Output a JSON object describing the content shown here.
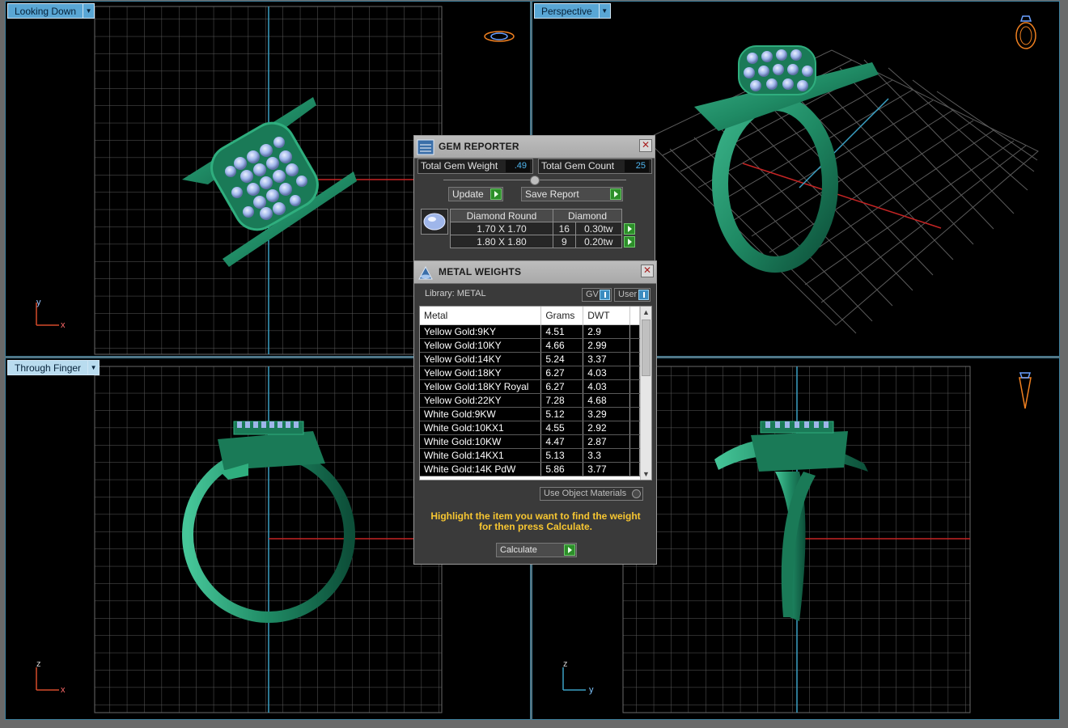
{
  "viewports": {
    "top_left": {
      "label": "Looking Down",
      "axis_v": "y",
      "axis_h": "x"
    },
    "top_right": {
      "label": "Perspective"
    },
    "bottom_left": {
      "label": "Through Finger",
      "axis_v": "z",
      "axis_h": "x"
    },
    "bottom_right": {
      "axis_v": "z",
      "axis_h": "y"
    }
  },
  "gem_reporter": {
    "title": "GEM REPORTER",
    "total_weight_label": "Total Gem Weight",
    "total_weight_value": ".49",
    "total_count_label": "Total Gem Count",
    "total_count_value": "25",
    "update_label": "Update",
    "save_report_label": "Save Report",
    "headers": [
      "Diamond Round",
      "Diamond"
    ],
    "rows": [
      {
        "size": "1.70 X 1.70",
        "count": "16",
        "weight": "0.30tw"
      },
      {
        "size": "1.80 X 1.80",
        "count": "9",
        "weight": "0.20tw"
      }
    ]
  },
  "metal_weights": {
    "title": "METAL WEIGHTS",
    "library_label": "Library: METAL",
    "gv_label": "GV",
    "user_label": "User",
    "headers": {
      "metal": "Metal",
      "grams": "Grams",
      "dwt": "DWT"
    },
    "rows": [
      {
        "metal": "Yellow Gold:9KY",
        "grams": "4.51",
        "dwt": "2.9"
      },
      {
        "metal": "Yellow Gold:10KY",
        "grams": "4.66",
        "dwt": "2.99"
      },
      {
        "metal": "Yellow Gold:14KY",
        "grams": "5.24",
        "dwt": "3.37"
      },
      {
        "metal": "Yellow Gold:18KY",
        "grams": "6.27",
        "dwt": "4.03"
      },
      {
        "metal": "Yellow Gold:18KY Royal",
        "grams": "6.27",
        "dwt": "4.03"
      },
      {
        "metal": "Yellow Gold:22KY",
        "grams": "7.28",
        "dwt": "4.68"
      },
      {
        "metal": "White Gold:9KW",
        "grams": "5.12",
        "dwt": "3.29"
      },
      {
        "metal": "White Gold:10KX1",
        "grams": "4.55",
        "dwt": "2.92"
      },
      {
        "metal": "White Gold:10KW",
        "grams": "4.47",
        "dwt": "2.87"
      },
      {
        "metal": "White Gold:14KX1",
        "grams": "5.13",
        "dwt": "3.3"
      },
      {
        "metal": "White Gold:14K PdW",
        "grams": "5.86",
        "dwt": "3.77"
      }
    ],
    "use_object_materials_label": "Use Object Materials",
    "hint_line1": "Highlight the item you want to find the weight",
    "hint_line2": "for then press Calculate.",
    "calculate_label": "Calculate"
  },
  "colors": {
    "ring_green": "#1f8a64",
    "gem_blue": "#9fb6ea",
    "grid": "#5b5b5b",
    "accent_blue": "#59a6d4",
    "hint_yellow": "#f7c631"
  }
}
